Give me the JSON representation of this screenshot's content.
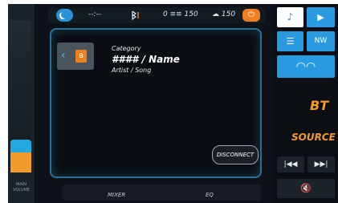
{
  "left_column": {
    "volume_label": "MAIN VOLUME",
    "volume_level_percent": 18
  },
  "top_bar": {
    "dash_text": "--:--",
    "temp_left": "0 ≡≡ 150",
    "temp_right": "☁ 150"
  },
  "main_panel": {
    "category_label": "Category",
    "name_label": "#### / Name",
    "artist_label": "Artist / Song",
    "disconnect_label": "DISCONNECT"
  },
  "bottom_tabs": {
    "mixer": "MIXER",
    "eq": "EQ"
  },
  "right_nav": {
    "bt_label": "BT",
    "source_label": "SOURCE",
    "nav_label": "NW"
  },
  "colors": {
    "accent_blue": "#2a9be0",
    "accent_orange": "#f07f22",
    "active_blue": "#24a8e0"
  },
  "icons": [
    "moon-icon",
    "bluetooth-icon",
    "power-icon",
    "music-note-icon",
    "video-icon",
    "sliders-icon",
    "nav-icon",
    "gauge-icon",
    "rewind-icon",
    "forward-icon",
    "mute-icon"
  ]
}
